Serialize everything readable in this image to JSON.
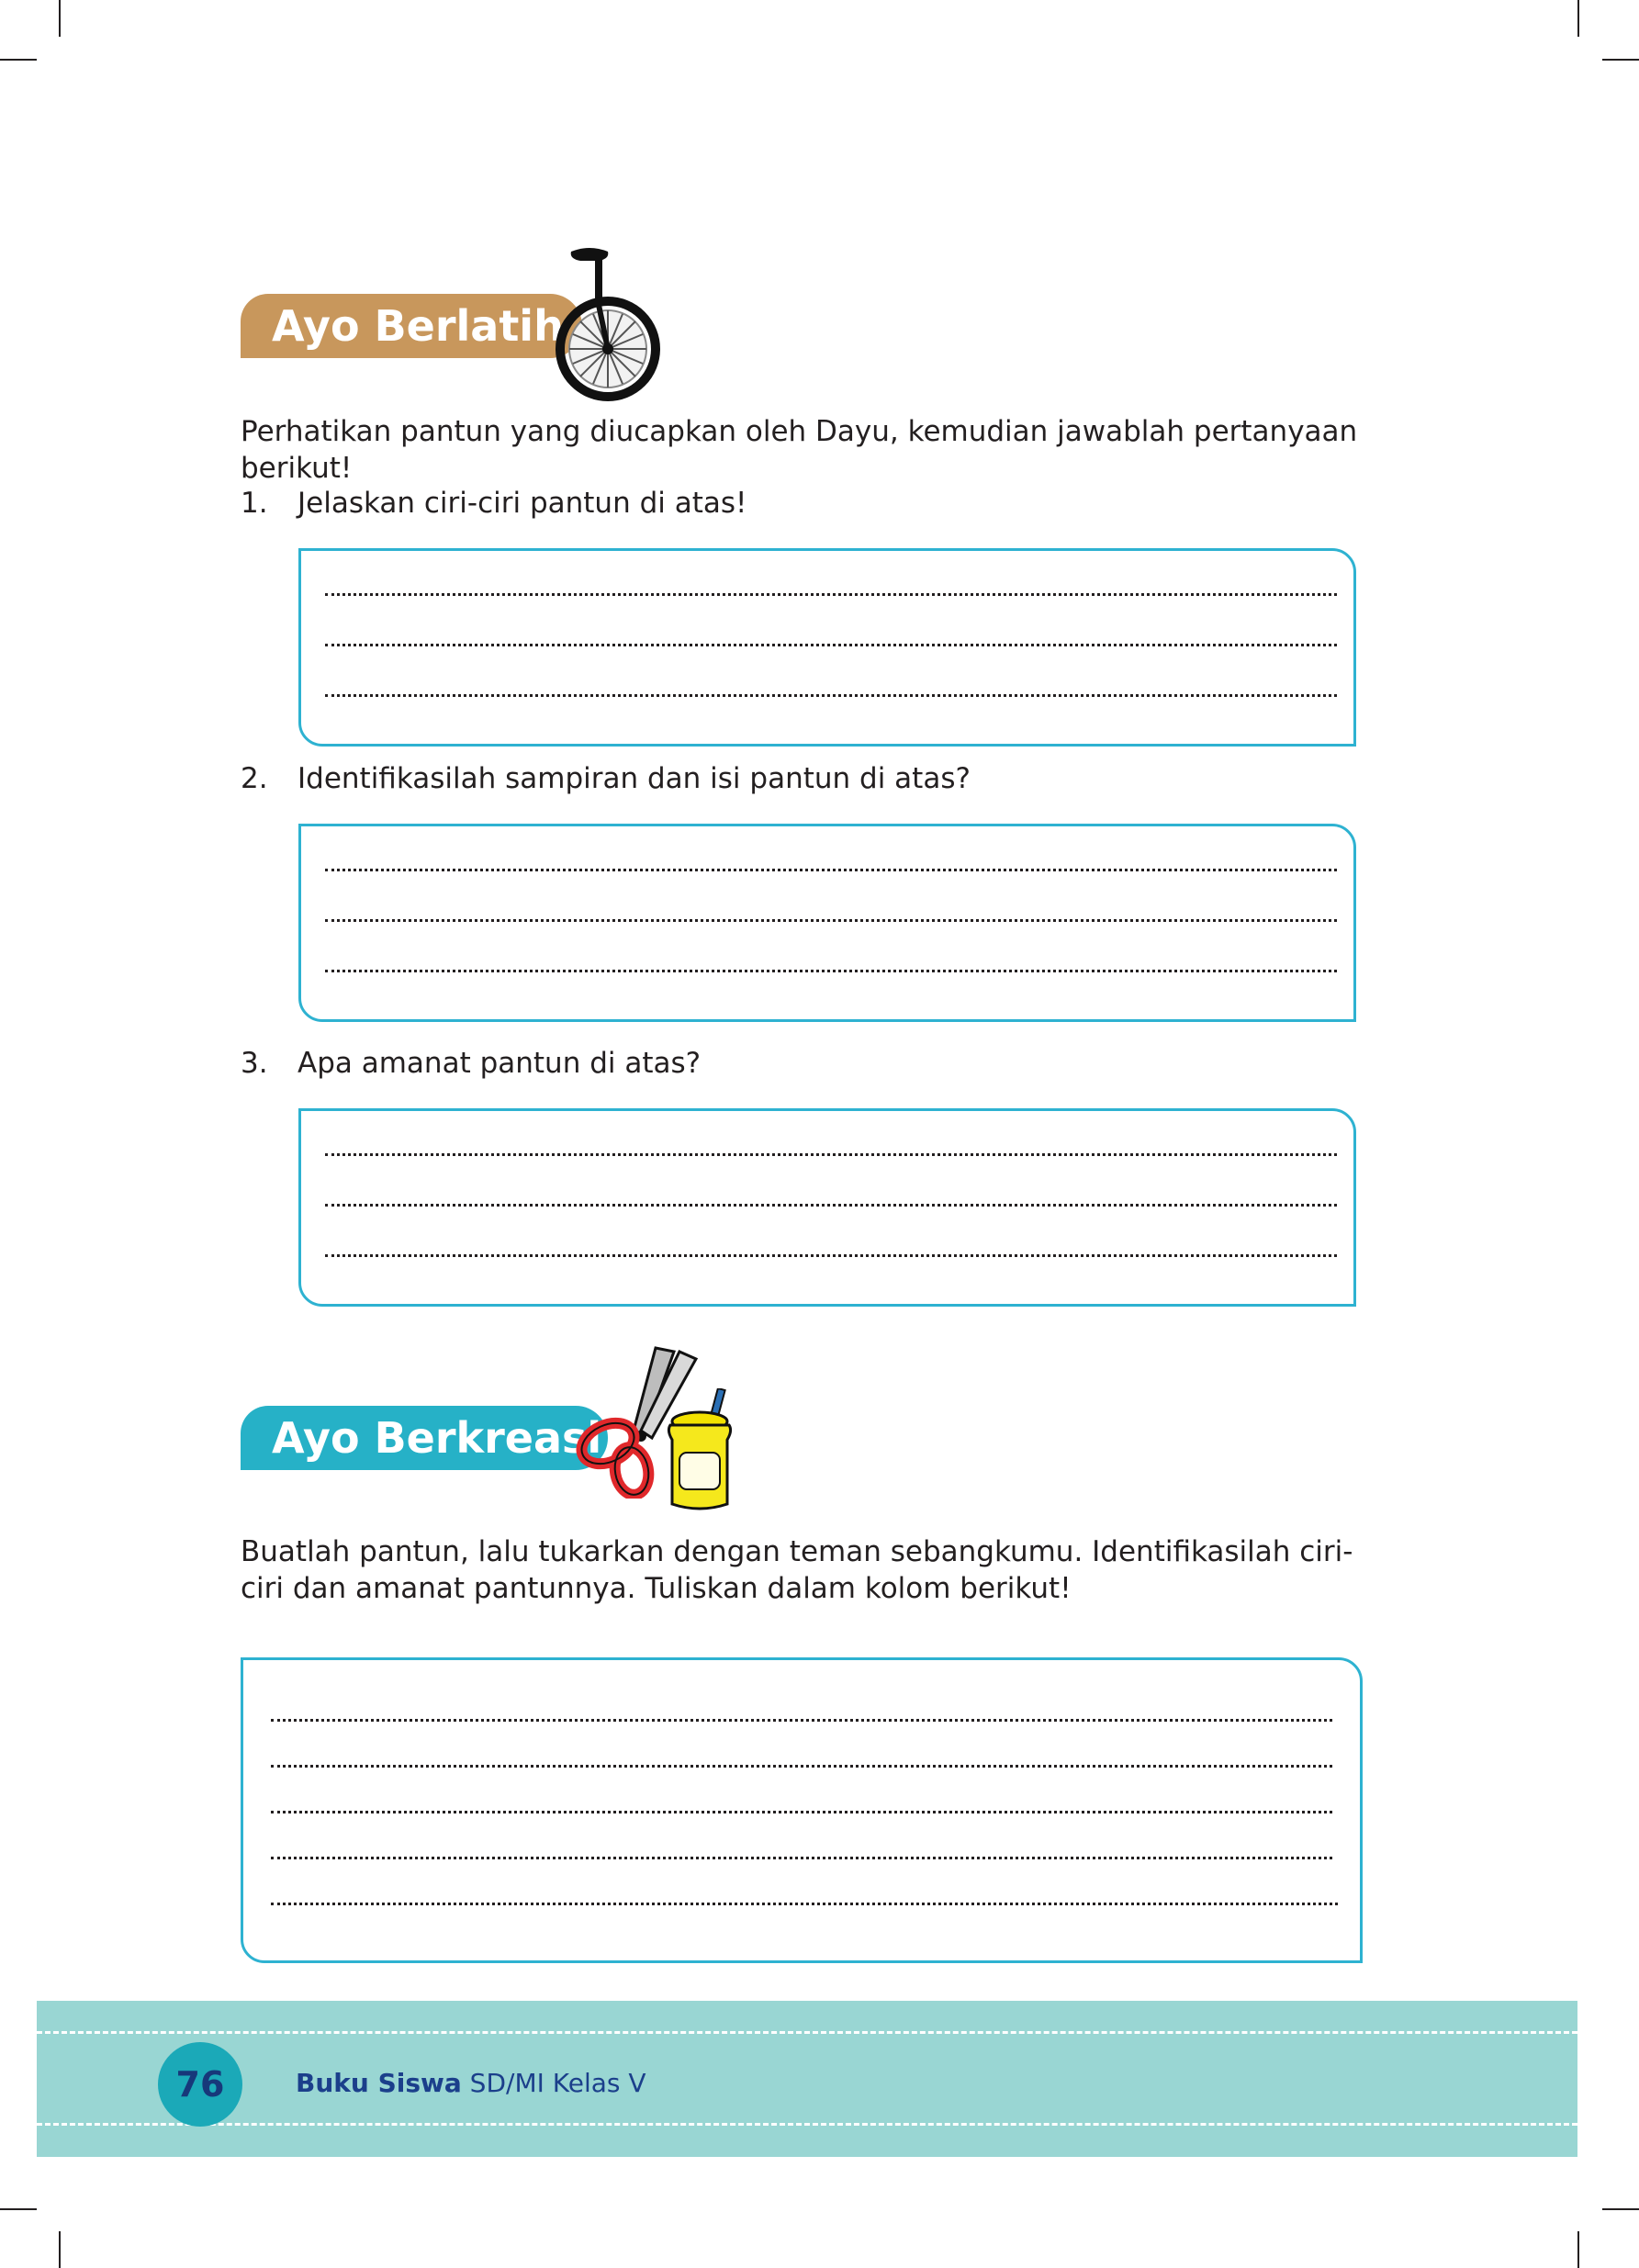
{
  "sections": {
    "berlatih": {
      "title": "Ayo Berlatih",
      "intro": "Perhatikan pantun yang diucapkan oleh Dayu, kemudian jawablah pertanyaan berikut!",
      "questions": [
        {
          "number": "1.",
          "text": "Jelaskan ciri-ciri pantun di atas!"
        },
        {
          "number": "2.",
          "text": "Identifikasilah sampiran dan isi pantun di atas?"
        },
        {
          "number": "3.",
          "text": "Apa amanat pantun di atas?"
        }
      ]
    },
    "berkreasi": {
      "title": "Ayo Berkreasi",
      "instruction": "Buatlah pantun, lalu tukarkan dengan teman sebangkumu. Identifikasilah ciri-ciri dan amanat pantunnya. Tuliskan dalam kolom berikut!"
    }
  },
  "footer": {
    "page_number": "76",
    "book_title_bold": "Buku Siswa",
    "book_title_rest": " SD/MI Kelas V"
  },
  "colors": {
    "berlatih_pill": "#c8975c",
    "berkreasi_pill": "#26b1c7",
    "answer_box_border": "#2eb2d1",
    "footer_band": "#99d6d3"
  },
  "icons": [
    "unicycle-icon",
    "scissors-icon",
    "glue-jar-icon"
  ]
}
